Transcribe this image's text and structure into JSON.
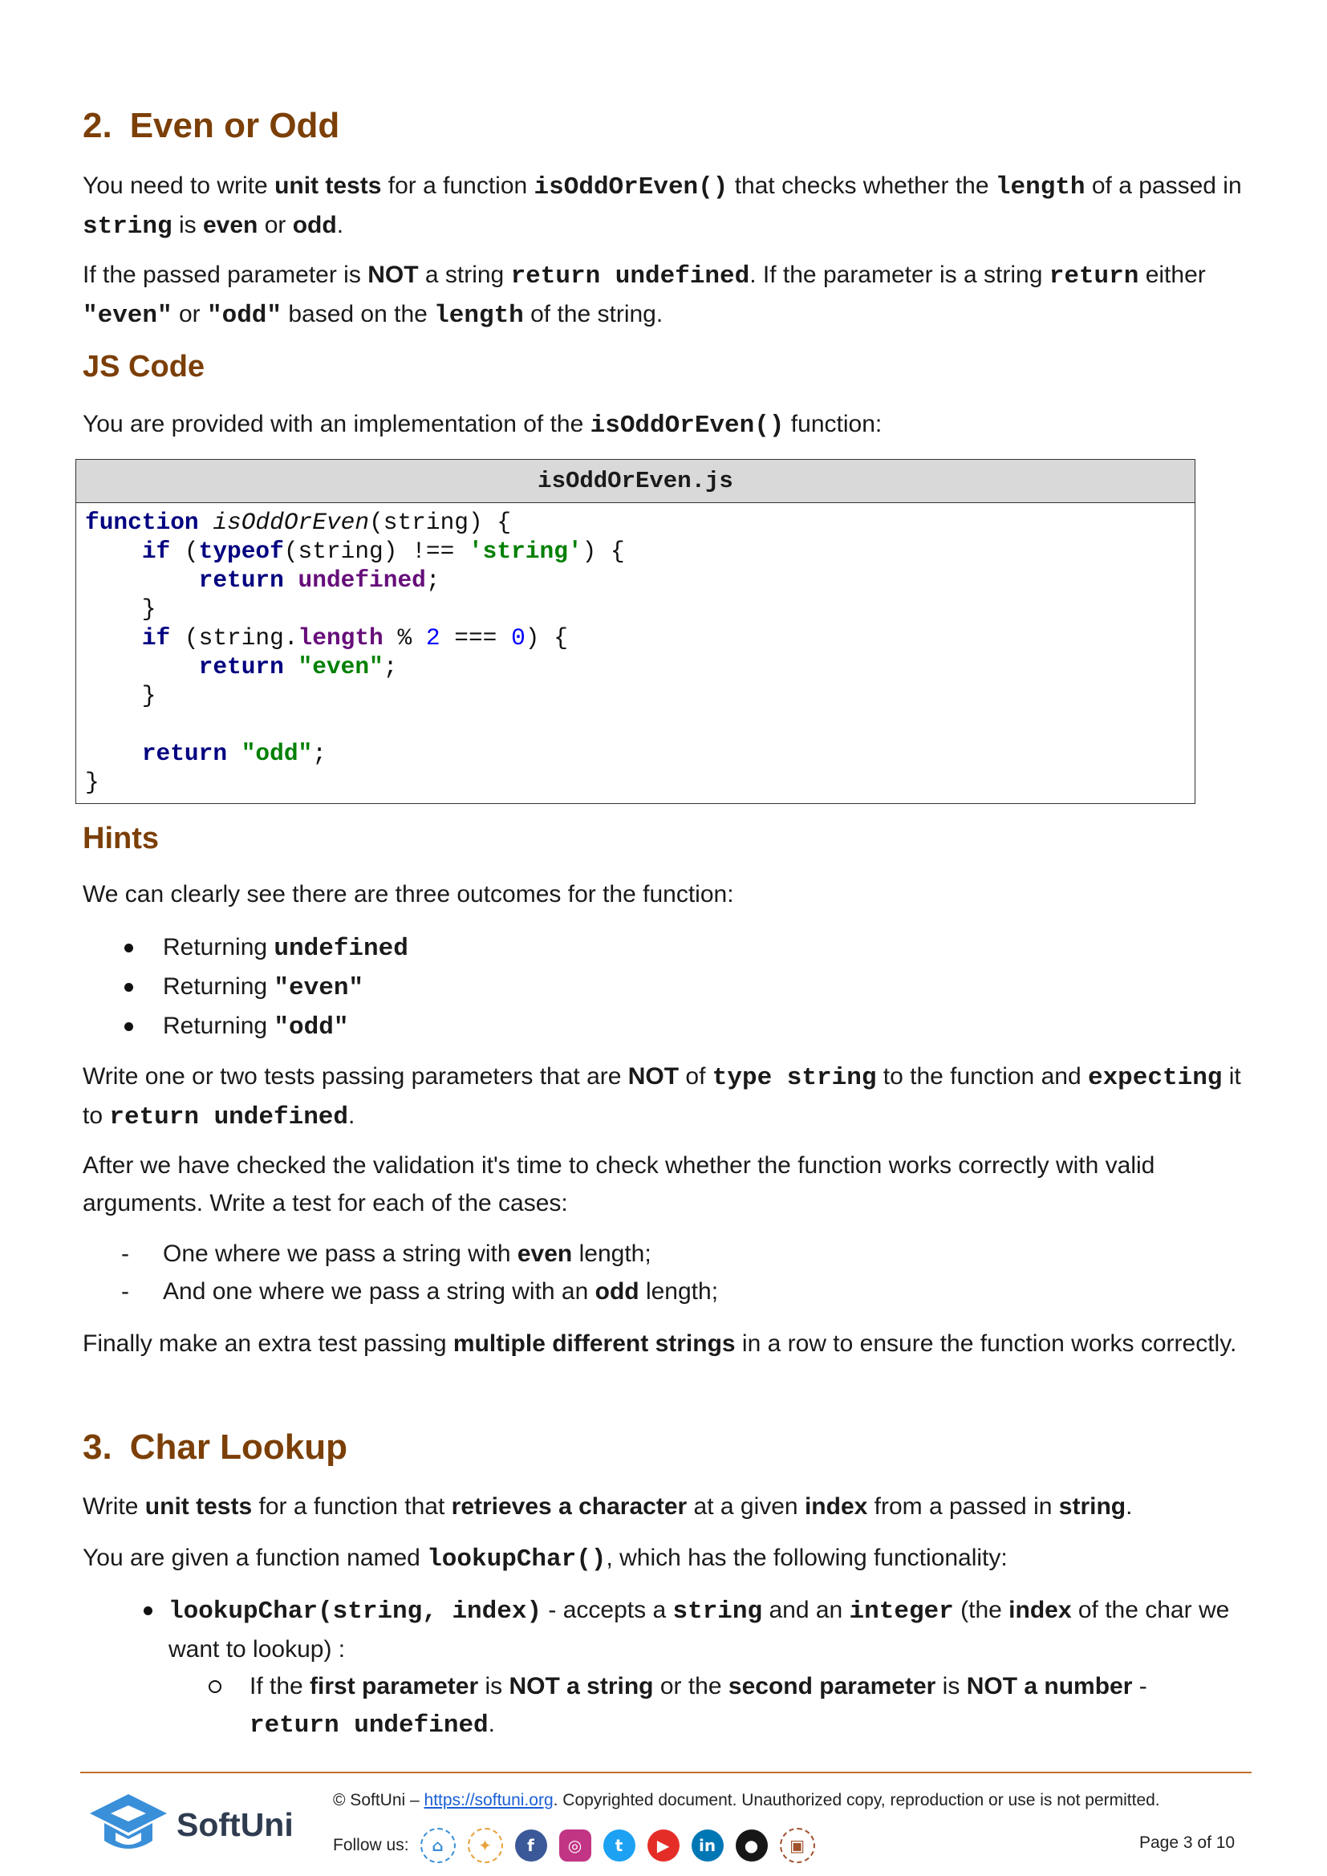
{
  "section2": {
    "number": "2.",
    "title": "Even or Odd",
    "intro": {
      "t1": "You need to write ",
      "b1": "unit tests",
      "t2": " for a function ",
      "c1": "isOddOrEven()",
      "t3": " that checks whether the ",
      "c2": "length",
      "t4": " of a passed in ",
      "c3": "string",
      "t5": " is ",
      "b2": "even",
      "t6": " or ",
      "b3": "odd",
      "t7": "."
    },
    "rule": {
      "t1": "If the passed parameter is ",
      "b1": "NOT",
      "t2": " a string ",
      "c1": "return undefined",
      "t3": ". If the parameter is a string ",
      "c2": "return",
      "t4": " either ",
      "c3": "\"even\"",
      "t5": " or ",
      "c4": "\"odd\"",
      "t6": " based on the ",
      "c5": "length",
      "t7": " of the string."
    },
    "js_heading": "JS Code",
    "provided": {
      "t1": "You are provided with an implementation of the ",
      "c1": "isOddOrEven()",
      "t2": " function:"
    },
    "code_filename": "isOddOrEven.js",
    "hints_heading": "Hints",
    "outcomes_intro": "We can clearly see there are three outcomes for the function:",
    "outcomes": [
      {
        "text": "Returning ",
        "code": "undefined"
      },
      {
        "text": "Returning ",
        "code": "\"even\""
      },
      {
        "text": "Returning ",
        "code": "\"odd\""
      }
    ],
    "tests_para": {
      "t1": "Write one or two tests passing parameters that are ",
      "b1": "NOT",
      "t2": " of ",
      "c1": "type string",
      "t3": " to the function and ",
      "c2": "expecting",
      "t4": " it to ",
      "c3": "return undefined",
      "t5": "."
    },
    "validation_para": "After we have checked the validation it's time to check whether the function works correctly with valid arguments. Write a test for each of the cases:",
    "cases": [
      {
        "t1": "One where we pass a string with ",
        "b": "even",
        "t2": " length;"
      },
      {
        "t1": "And one where we pass a string with an ",
        "b": "odd",
        "t2": " length;"
      }
    ],
    "final_para": {
      "t1": "Finally make an extra test passing ",
      "b1": "multiple different strings",
      "t2": " in a row to ensure the function works correctly."
    }
  },
  "section3": {
    "number": "3.",
    "title": "Char Lookup",
    "intro": {
      "t1": "Write ",
      "b1": "unit tests",
      "t2": " for a function that ",
      "b2": "retrieves a character",
      "t3": " at a given ",
      "b3": "index",
      "t4": " from a passed in ",
      "b4": "string",
      "t5": "."
    },
    "given": {
      "t1": "You are given a function named ",
      "c1": "lookupChar()",
      "t2": ", which has the following functionality:"
    },
    "bullet": {
      "c1": "lookupChar(string, index)",
      "t1": " - accepts a ",
      "c2": "string",
      "t2": " and an ",
      "c3": "integer",
      "t3": " (the ",
      "b1": "index",
      "t4": " of the char we want to lookup) :"
    },
    "sub": {
      "t1": "If the ",
      "b1": "first parameter",
      "t2": " is ",
      "b2": "NOT a string",
      "t3": " or the ",
      "b3": "second parameter",
      "t4": " is ",
      "b4": "NOT a number",
      "t5": " - ",
      "c1": "return undefined",
      "t6": "."
    }
  },
  "footer": {
    "logo_text": "SoftUni",
    "copyright_prefix": "© SoftUni – ",
    "link": "https://softuni.org",
    "copyright_suffix": ". Copyrighted document. Unauthorized copy, reproduction or use is not permitted.",
    "follow_label": "Follow us:",
    "social_icons": [
      "softuni-icon",
      "softuni-creative-icon",
      "facebook-icon",
      "instagram-icon",
      "twitter-icon",
      "youtube-icon",
      "linkedin-icon",
      "github-icon",
      "softuni-box-icon"
    ],
    "page_label": "Page 3 of 10"
  }
}
